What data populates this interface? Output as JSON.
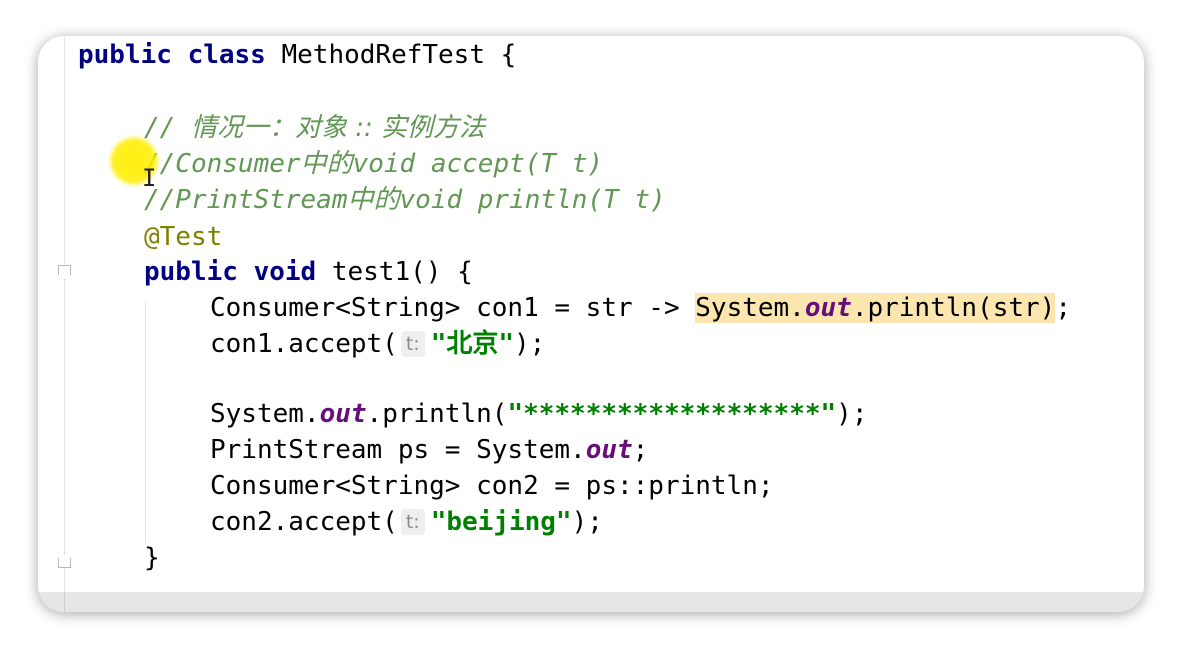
{
  "editor": {
    "lines": [
      {
        "parts": [
          {
            "t": "public class ",
            "c": "kw"
          },
          {
            "t": "MethodRefTest {"
          }
        ]
      },
      {
        "parts": []
      },
      {
        "parts": [
          {
            "t": "// ",
            "c": "cm"
          },
          {
            "t": "情况一：对象 :: 实例方法",
            "c": "cmc"
          }
        ]
      },
      {
        "parts": [
          {
            "t": "//Consumer",
            "c": "cm"
          },
          {
            "t": "中的",
            "c": "cmc"
          },
          {
            "t": "void accept(T t)",
            "c": "cm"
          }
        ]
      },
      {
        "parts": [
          {
            "t": "//PrintStream",
            "c": "cm"
          },
          {
            "t": "中的",
            "c": "cmc"
          },
          {
            "t": "void println(T t)",
            "c": "cm"
          }
        ]
      },
      {
        "parts": [
          {
            "t": "@Test",
            "c": "ann"
          }
        ]
      },
      {
        "parts": [
          {
            "t": "public void ",
            "c": "kw"
          },
          {
            "t": "test1() {"
          }
        ]
      },
      {
        "parts": [
          {
            "t": "Consumer<String> con1 = str -> "
          },
          {
            "t": "System.",
            "c": "hl"
          },
          {
            "t": "out",
            "c": "fld hl"
          },
          {
            "t": ".println(str)",
            "c": "hl"
          },
          {
            "t": ";"
          }
        ]
      },
      {
        "parts": [
          {
            "t": "con1.accept("
          },
          {
            "t": "t:",
            "c": "hint"
          },
          {
            "t": "\"北京\"",
            "c": "str"
          },
          {
            "t": ");"
          }
        ]
      },
      {
        "parts": []
      },
      {
        "parts": [
          {
            "t": "System."
          },
          {
            "t": "out",
            "c": "fld"
          },
          {
            "t": ".println("
          },
          {
            "t": "\"*******************\"",
            "c": "str"
          },
          {
            "t": ");"
          }
        ]
      },
      {
        "parts": [
          {
            "t": "PrintStream ps = System."
          },
          {
            "t": "out",
            "c": "fld"
          },
          {
            "t": ";"
          }
        ]
      },
      {
        "parts": [
          {
            "t": "Consumer<String> con2 = ps::println;"
          }
        ]
      },
      {
        "parts": [
          {
            "t": "con2.accept("
          },
          {
            "t": "t:",
            "c": "hint"
          },
          {
            "t": "\"beijing\"",
            "c": "str"
          },
          {
            "t": ");"
          }
        ]
      },
      {
        "parts": [
          {
            "t": "}"
          }
        ]
      }
    ]
  }
}
